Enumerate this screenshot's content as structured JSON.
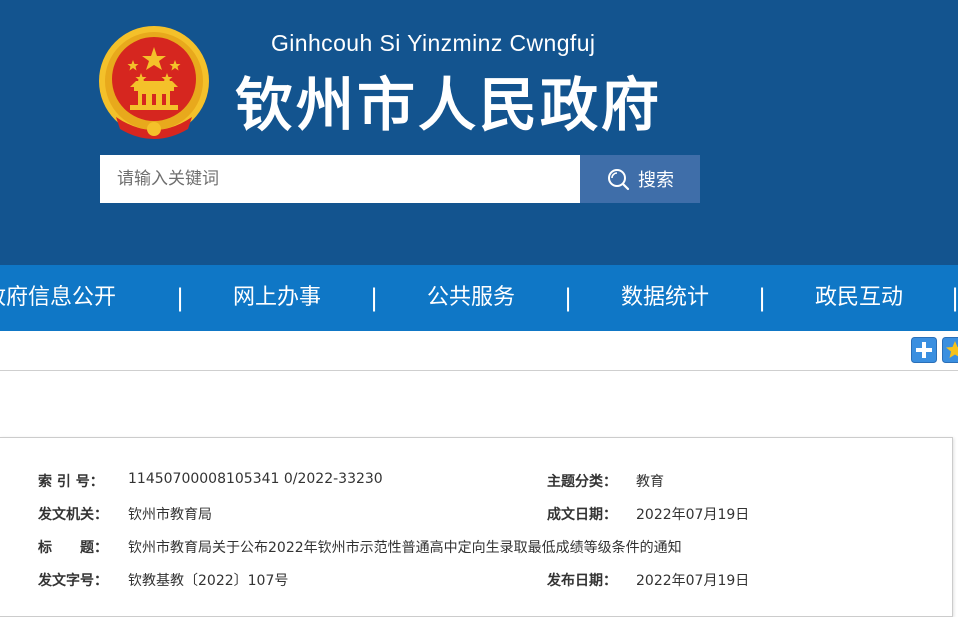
{
  "header": {
    "subtitle": "Ginhcouh Si Yinzminz Cwngfuj",
    "title": "钦州市人民政府",
    "emblem_icon": "national-emblem-icon"
  },
  "search": {
    "placeholder": "请输入关键词",
    "button_label": "搜索",
    "button_icon": "search-icon"
  },
  "nav": {
    "items": [
      {
        "label": "政府信息公开"
      },
      {
        "label": "网上办事"
      },
      {
        "label": "公共服务"
      },
      {
        "label": "数据统计"
      },
      {
        "label": "政民互动"
      }
    ],
    "separator": "|"
  },
  "toolbar": {
    "buttons": [
      {
        "icon": "plus-icon"
      },
      {
        "icon": "star-icon"
      }
    ]
  },
  "info": {
    "index_label": "索 引 号：",
    "index_value": "11450700008105341 0/2022-33230",
    "topic_label": "主题分类：",
    "topic_value": "教育",
    "issuer_label": "发文机关：",
    "issuer_value": "钦州市教育局",
    "date_label": "成文日期：",
    "date_value": "2022年07月19日",
    "title_label": "标　　题：",
    "title_value": "钦州市教育局关于公布2022年钦州市示范性普通高中定向生录取最低成绩等级条件的通知",
    "docno_label": "发文字号：",
    "docno_value": "钦教基教〔2022〕107号",
    "pubdate_label": "发布日期：",
    "pubdate_value": "2022年07月19日"
  },
  "colors": {
    "header_bg": "#13548f",
    "nav_bg": "#0f77c6",
    "search_btn_bg": "#3f6ea9",
    "emblem_red": "#d6261f",
    "emblem_gold": "#f4c12a"
  }
}
